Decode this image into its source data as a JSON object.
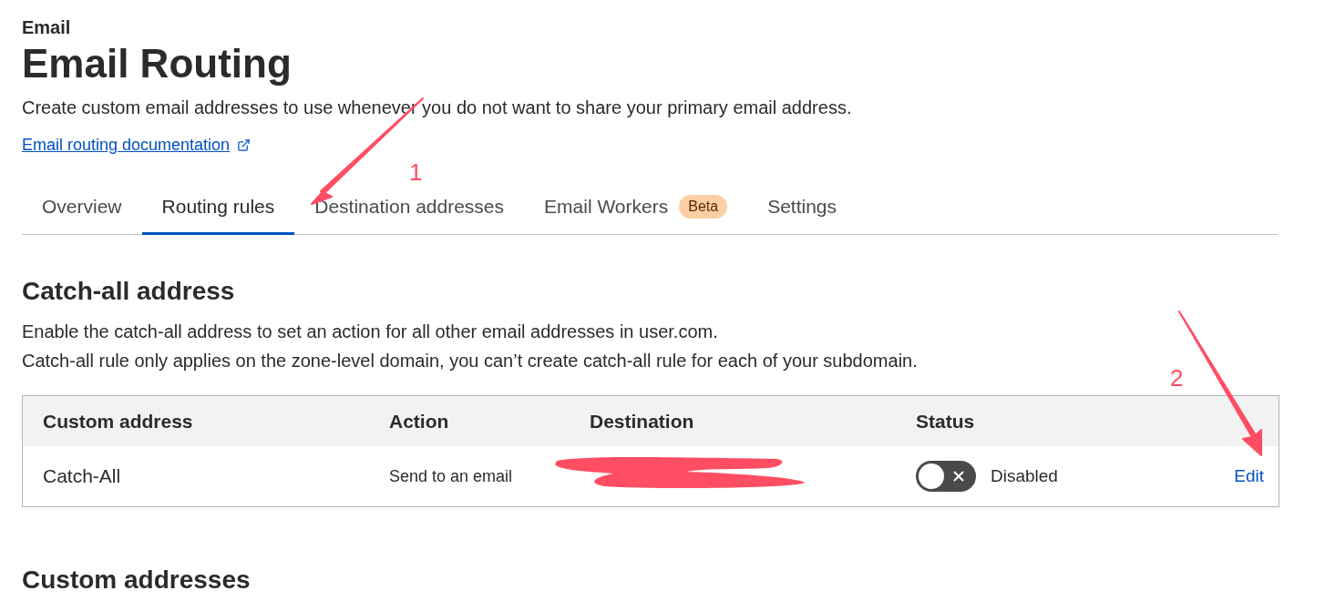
{
  "breadcrumb": "Email",
  "title": "Email Routing",
  "description": "Create custom email addresses to use whenever you do not want to share your primary email address.",
  "doc_link": "Email routing documentation",
  "tabs": [
    {
      "label": "Overview",
      "selected": false
    },
    {
      "label": "Routing rules",
      "selected": true
    },
    {
      "label": "Destination addresses",
      "selected": false
    },
    {
      "label": "Email Workers",
      "selected": false,
      "badge": "Beta"
    },
    {
      "label": "Settings",
      "selected": false
    }
  ],
  "catch_all": {
    "heading": "Catch-all address",
    "lines": [
      "Enable the catch-all address to set an action for all other email addresses in user.com.",
      "Catch-all rule only applies on the zone-level domain, you can’t create catch-all rule for each of your subdomain."
    ],
    "table": {
      "columns": [
        "Custom address",
        "Action",
        "Destination",
        "Status"
      ],
      "rows": [
        {
          "custom_address": "Catch-All",
          "action": "Send to an email",
          "on": false,
          "status": "Disabled",
          "edit": "Edit"
        }
      ]
    }
  },
  "next_heading": "Custom addresses",
  "annotations": [
    {
      "label": "1"
    },
    {
      "label": "2"
    }
  ]
}
